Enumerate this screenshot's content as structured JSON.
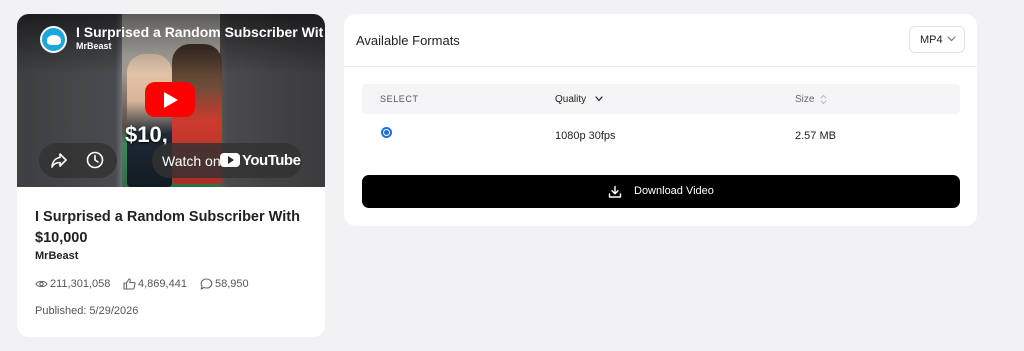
{
  "video": {
    "thumbnail_title": "I Surprised a Random Subscriber Wit",
    "channel": "MrBeast",
    "thumb_caption": "$10,",
    "watch_on": "Watch on",
    "youtube_label": "YouTube"
  },
  "info": {
    "title": "I Surprised a Random Subscriber With $10,000",
    "channel": "MrBeast",
    "views": "211,301,058",
    "likes": "4,869,441",
    "comments": "58,950",
    "published": "Published: 5/29/2026"
  },
  "formats_panel": {
    "title": "Available Formats",
    "format_select": "MP4",
    "columns": {
      "select": "SELECT",
      "quality": "Quality",
      "size": "Size"
    },
    "rows": [
      {
        "selected": true,
        "quality": "1080p 30fps",
        "size": "2.57 MB"
      }
    ],
    "download_label": "Download Video"
  },
  "colors": {
    "accent": "#1f6fe0",
    "button_bg": "#000000",
    "youtube_red": "#ff0000"
  }
}
